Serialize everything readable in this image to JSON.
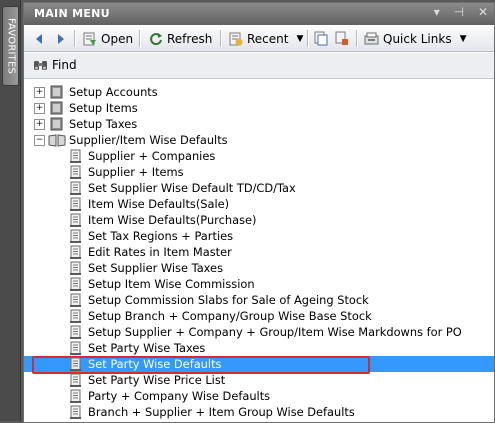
{
  "sidebar": {
    "favorites_label": "FAVORITES"
  },
  "window": {
    "title": "MAIN MENU"
  },
  "toolbar": {
    "open_label": "Open",
    "refresh_label": "Refresh",
    "recent_label": "Recent",
    "quick_links_label": "Quick Links"
  },
  "findbar": {
    "find_label": "Find"
  },
  "tree": {
    "groups": [
      {
        "label": "Setup Accounts",
        "expanded": false
      },
      {
        "label": "Setup Items",
        "expanded": false
      },
      {
        "label": "Setup Taxes",
        "expanded": false
      },
      {
        "label": "Supplier/Item Wise Defaults",
        "expanded": true
      }
    ],
    "items": [
      "Supplier + Companies",
      "Supplier + Items",
      "Set Supplier Wise Default TD/CD/Tax",
      "Item Wise Defaults(Sale)",
      "Item Wise Defaults(Purchase)",
      "Set Tax Regions + Parties",
      "Edit Rates in Item Master",
      "Set Supplier Wise Taxes",
      "Setup Item Wise Commission",
      "Setup Commission Slabs for Sale of Ageing Stock",
      "Setup Branch + Company/Group Wise Base Stock",
      "Setup Supplier + Company + Group/Item Wise Markdowns for PO",
      "Set Party Wise Taxes",
      "Set Party Wise Defaults",
      "Set Party Wise Price List",
      "Party + Company Wise Defaults",
      "Branch + Supplier + Item Group Wise Defaults"
    ],
    "selected_item": "Set Party Wise Defaults"
  },
  "colors": {
    "selection": "#3399ff",
    "highlight_outline": "#d42b2b",
    "titlebar": "#707070"
  }
}
